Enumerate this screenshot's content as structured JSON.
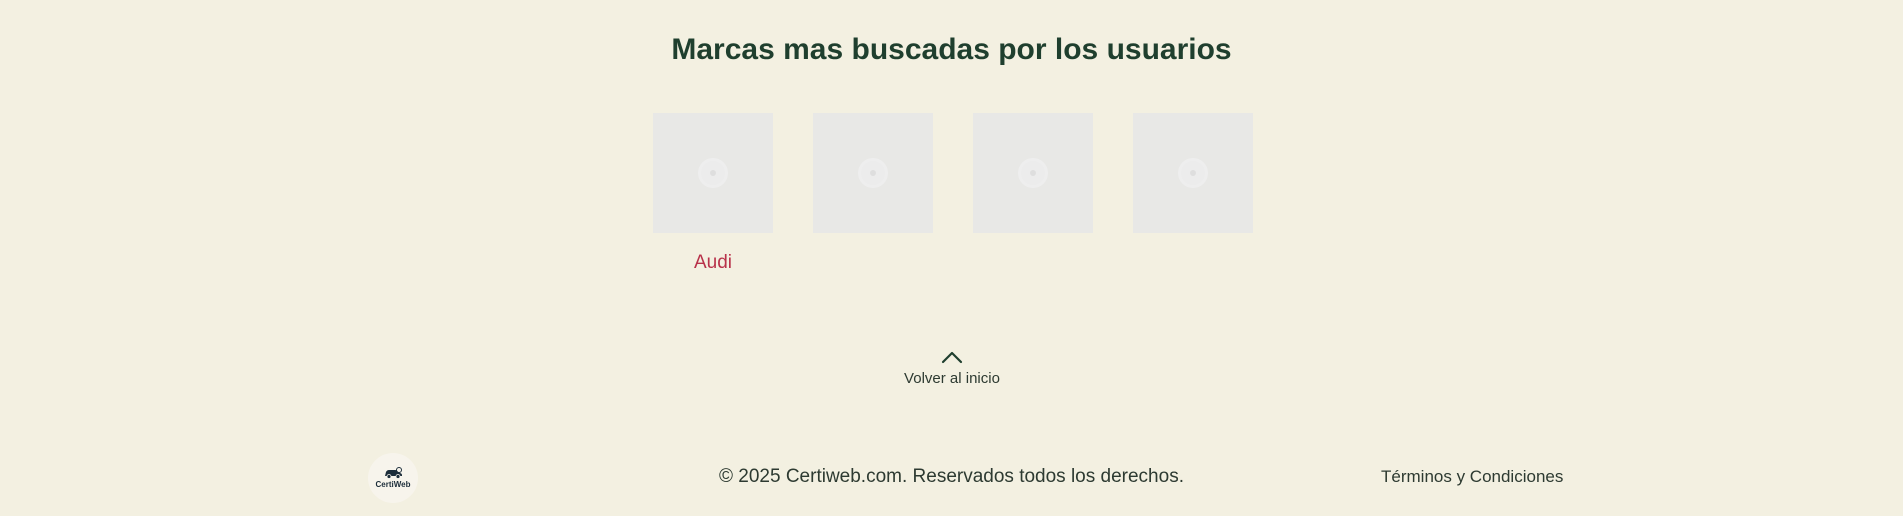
{
  "section": {
    "title": "Marcas mas buscadas por los usuarios"
  },
  "brands": [
    {
      "name": "Audi",
      "icon": "image-placeholder-icon"
    },
    {
      "name": "",
      "icon": "image-placeholder-icon"
    },
    {
      "name": "",
      "icon": "image-placeholder-icon"
    },
    {
      "name": "",
      "icon": "image-placeholder-icon"
    }
  ],
  "back_to_top": {
    "label": "Volver al inicio",
    "icon": "chevron-up-icon"
  },
  "footer": {
    "logo_text": "CertiWeb",
    "copyright": "© 2025 Certiweb.com. Reservados todos los derechos.",
    "terms_label": "Términos y Condiciones"
  },
  "colors": {
    "background": "#f3f0e1",
    "title": "#1f3f2e",
    "brand_name": "#b8324a",
    "text": "#2d3a31"
  }
}
